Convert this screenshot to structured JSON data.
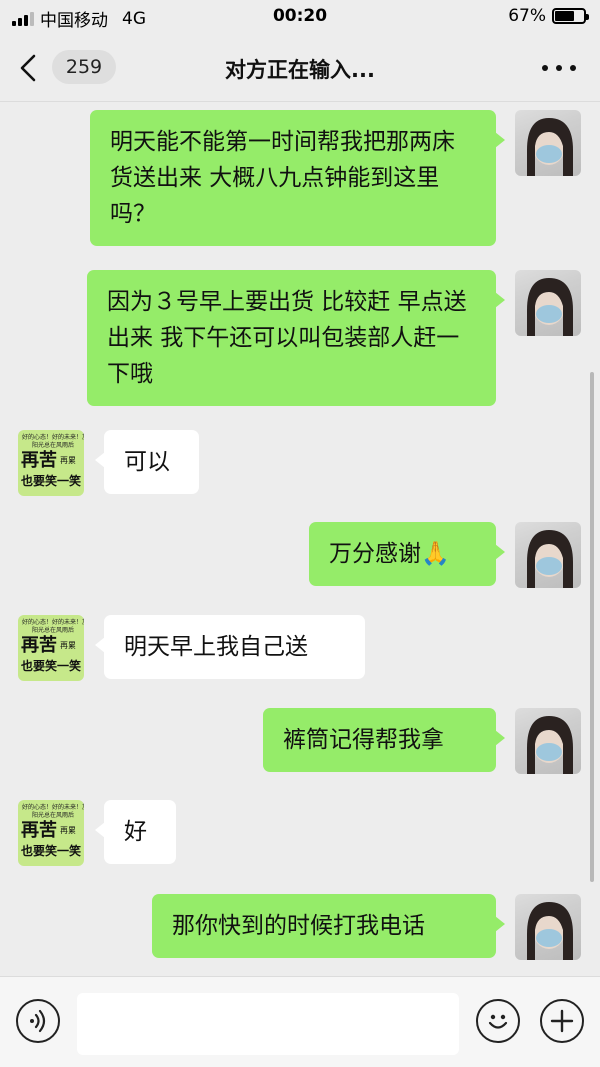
{
  "status_bar": {
    "carrier": "中国移动",
    "network": "4G",
    "time": "00:20",
    "battery_percent": "67%",
    "battery_level": 0.67
  },
  "nav": {
    "unread_count": "259",
    "title": "对方正在输入..."
  },
  "them_avatar": {
    "line1": "好的心态！好的未来！加油",
    "line2": "阳光总在风雨后",
    "big1": "再苦",
    "side1": "再累",
    "big2": "也要笑一笑"
  },
  "messages": [
    {
      "sender": "me",
      "text": "明天能不能第一时间帮我把那两床货送出来 大概八九点钟能到这里吗？"
    },
    {
      "sender": "me",
      "text": "因为３号早上要出货 比较赶 早点送出来 我下午还可以叫包装部人赶一下哦"
    },
    {
      "sender": "them",
      "text": "可以"
    },
    {
      "sender": "me",
      "text": "万分感谢🙏"
    },
    {
      "sender": "them",
      "text": "明天早上我自己送"
    },
    {
      "sender": "me",
      "text": "裤筒记得帮我拿"
    },
    {
      "sender": "them",
      "text": "好"
    },
    {
      "sender": "me",
      "text": "那你快到的时候打我电话"
    }
  ],
  "icons": {
    "back": "chevron-left-icon",
    "more": "more-dots-icon",
    "voice": "voice-icon",
    "emoji": "emoji-icon",
    "plus": "plus-icon"
  },
  "colors": {
    "my_bubble": "#95ec69",
    "their_bubble": "#ffffff",
    "background": "#ededed"
  }
}
